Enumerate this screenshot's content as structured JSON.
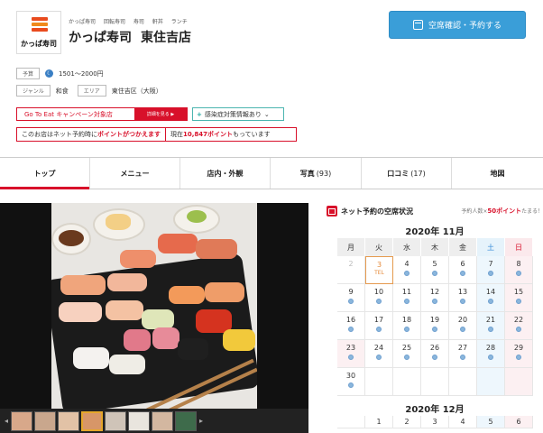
{
  "header": {
    "logo_text": "かっぱ寿司",
    "tags": [
      "かっぱ寿司",
      "回転寿司",
      "寿司",
      "軒丼",
      "ランチ"
    ],
    "shop_name": "かっぱ寿司",
    "branch": "東住吉店",
    "reserve_button": "空席確認・予約する"
  },
  "info": {
    "budget_label": "予算",
    "budget_value": "1501〜2000円",
    "genre_label": "ジャンル",
    "genre_value": "和食",
    "area_label": "エリア",
    "area_value": "東住吉区（大阪）"
  },
  "campaign": {
    "goto_text": "Go To Eat キャンペーン対象店",
    "goto_link": "詳細を見る ▶",
    "infection_text": "感染症対策情報あり",
    "points_pre": "このお店はネット予約時に",
    "points_em": "ポイントがつかえます",
    "points_now_pre": "現在",
    "points_now_em": "10,847ポイント",
    "points_now_post": "もっています"
  },
  "tabs": [
    {
      "label": "トップ",
      "count": ""
    },
    {
      "label": "メニュー",
      "count": ""
    },
    {
      "label": "店内・外観",
      "count": ""
    },
    {
      "label": "写真",
      "count": "(93)"
    },
    {
      "label": "口コミ",
      "count": "(17)"
    },
    {
      "label": "地図",
      "count": ""
    }
  ],
  "calendar": {
    "title": "ネット予約の空席状況",
    "promo_pre": "予約人数×",
    "promo_em": "50ポイント",
    "promo_post": "たまる！",
    "month1": "2020年 11月",
    "month2": "2020年 12月",
    "dow": [
      "月",
      "火",
      "水",
      "木",
      "金",
      "土",
      "日"
    ],
    "today_tel": "TEL",
    "weeks_nov": [
      [
        "2",
        "3",
        "4",
        "5",
        "6",
        "7",
        "8"
      ],
      [
        "9",
        "10",
        "11",
        "12",
        "13",
        "14",
        "15"
      ],
      [
        "16",
        "17",
        "18",
        "19",
        "20",
        "21",
        "22"
      ],
      [
        "23",
        "24",
        "25",
        "26",
        "27",
        "28",
        "29"
      ],
      [
        "30",
        "",
        "",
        "",
        "",
        "",
        ""
      ]
    ],
    "dec_first_row": [
      "",
      "1",
      "2",
      "3",
      "4",
      "5",
      "6"
    ]
  },
  "colors": {
    "accent_red": "#d8102a",
    "reserve_blue": "#3a9ed8",
    "sat_blue": "#3a8dd8"
  }
}
